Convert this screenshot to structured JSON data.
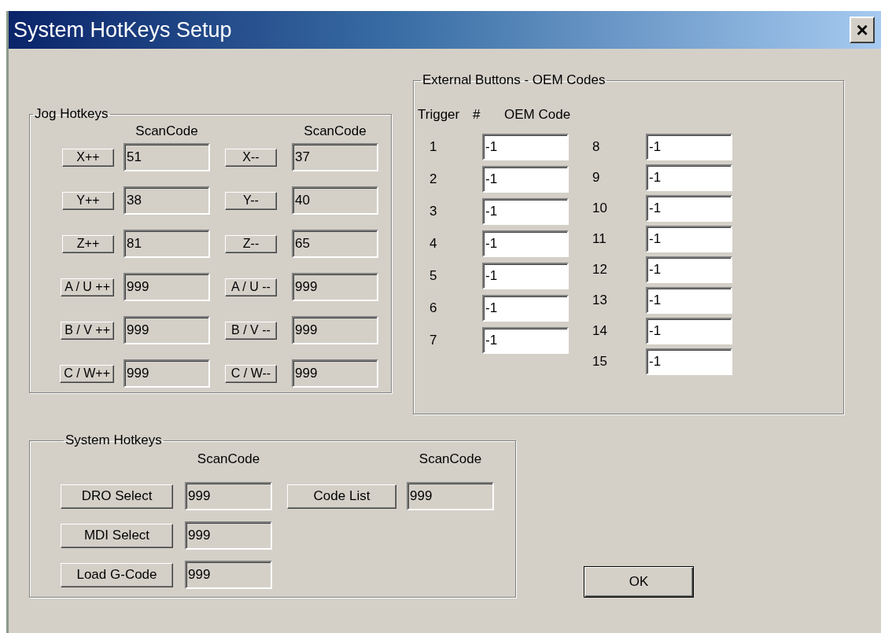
{
  "window": {
    "title": "System HotKeys Setup",
    "close": "×"
  },
  "jog_hotkeys": {
    "title": "Jog Hotkeys",
    "columns": [
      {
        "header": "ScanCode",
        "items": [
          {
            "button": "X++",
            "value": "51",
            "readonly": true
          },
          {
            "button": "Y++",
            "value": "38",
            "readonly": true
          },
          {
            "button": "Z++",
            "value": "81",
            "readonly": true
          },
          {
            "button": "A / U ++",
            "value": "999",
            "readonly": true
          },
          {
            "button": "B / V ++",
            "value": "999",
            "readonly": true
          },
          {
            "button": "C / W++",
            "value": "999",
            "readonly": true
          }
        ]
      },
      {
        "header": "ScanCode",
        "items": [
          {
            "button": "X--",
            "value": "37",
            "readonly": true
          },
          {
            "button": "Y--",
            "value": "40",
            "readonly": true
          },
          {
            "button": "Z--",
            "value": "65",
            "readonly": true
          },
          {
            "button": "A / U --",
            "value": "999",
            "readonly": true
          },
          {
            "button": "B / V --",
            "value": "999",
            "readonly": true
          },
          {
            "button": "C / W--",
            "value": "999",
            "readonly": true
          }
        ]
      }
    ]
  },
  "external_buttons": {
    "title": "External Buttons - OEM Codes",
    "header_trigger": "Trigger",
    "header_hash": "#",
    "header_code": "OEM Code",
    "columns": [
      {
        "triggers": [
          {
            "number": "1",
            "code": "-1",
            "readonly": false
          },
          {
            "number": "2",
            "code": "-1",
            "readonly": false
          },
          {
            "number": "3",
            "code": "-1",
            "readonly": false
          },
          {
            "number": "4",
            "code": "-1",
            "readonly": false
          },
          {
            "number": "5",
            "code": "-1",
            "readonly": false
          },
          {
            "number": "6",
            "code": "-1",
            "readonly": false
          },
          {
            "number": "7",
            "code": "-1",
            "readonly": false
          }
        ]
      },
      {
        "triggers": [
          {
            "number": "8",
            "code": "-1",
            "readonly": false
          },
          {
            "number": "9",
            "code": "-1",
            "readonly": false
          },
          {
            "number": "10",
            "code": "-1",
            "readonly": false
          },
          {
            "number": "11",
            "code": "-1",
            "readonly": false
          },
          {
            "number": "12",
            "code": "-1",
            "readonly": false
          },
          {
            "number": "13",
            "code": "-1",
            "readonly": false
          },
          {
            "number": "14",
            "code": "-1",
            "readonly": false
          },
          {
            "number": "15",
            "code": "-1",
            "readonly": false
          }
        ]
      }
    ]
  },
  "system_hotkeys": {
    "title": "System Hotkeys",
    "columns": [
      {
        "header": "ScanCode",
        "items": [
          {
            "button": "DRO Select",
            "value": "999",
            "readonly": true
          },
          {
            "button": "MDI Select",
            "value": "999",
            "readonly": true
          },
          {
            "button": "Load G-Code",
            "value": "999",
            "readonly": true
          }
        ]
      },
      {
        "header": "ScanCode",
        "items": [
          {
            "button": "Code List",
            "value": "999",
            "readonly": true
          }
        ]
      }
    ]
  },
  "ok_button": "OK"
}
